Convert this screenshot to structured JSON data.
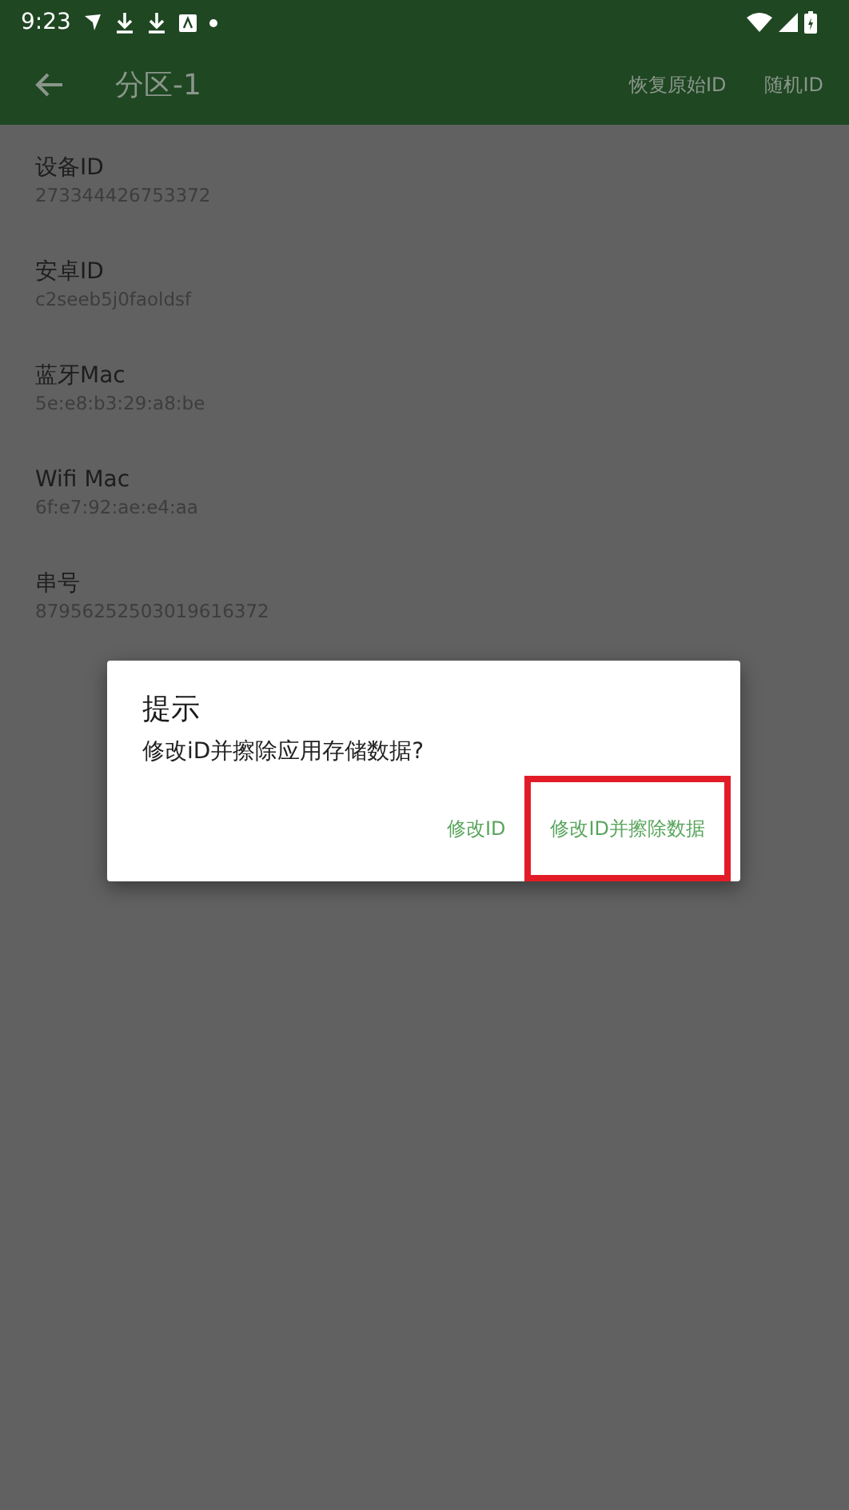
{
  "status_bar": {
    "time": "9:23"
  },
  "toolbar": {
    "title": "分区-1",
    "actions": [
      "恢复原始ID",
      "随机ID"
    ]
  },
  "fields": [
    {
      "label": "设备ID",
      "value": "273344426753372"
    },
    {
      "label": "安卓ID",
      "value": "c2seeb5j0faoldsf"
    },
    {
      "label": "蓝牙Mac",
      "value": "5e:e8:b3:29:a8:be"
    },
    {
      "label": "Wifi Mac",
      "value": "6f:e7:92:ae:e4:aa"
    },
    {
      "label": "串号",
      "value": "87956252503019616372"
    }
  ],
  "dialog": {
    "title": "提示",
    "message": "修改iD并擦除应用存储数据?",
    "buttons": [
      {
        "label": "修改ID",
        "highlighted": false
      },
      {
        "label": "修改ID并擦除数据",
        "highlighted": true
      }
    ]
  }
}
